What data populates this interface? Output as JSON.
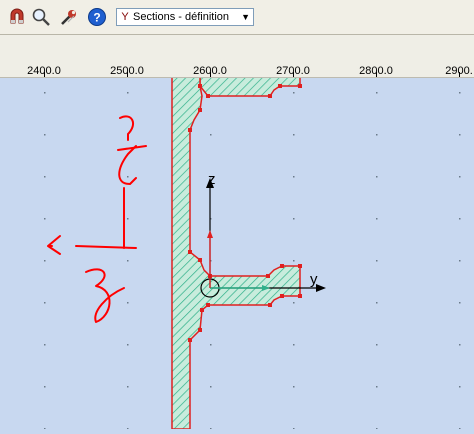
{
  "toolbar": {
    "icons": [
      "magnet-icon",
      "zoom-icon",
      "tools-icon",
      "help-icon"
    ],
    "section_select": {
      "value": "Sections - définition"
    }
  },
  "ruler": {
    "ticks": [
      "2400.0",
      "2500.0",
      "2600.0",
      "2700.0",
      "2800.0",
      "2900."
    ]
  },
  "axes": {
    "z_label": "z",
    "y_label": "y"
  },
  "colors": {
    "background": "#c8d8f0",
    "hatch": "#2fb08a",
    "outline": "#e02020",
    "ink": "#ff0000"
  }
}
